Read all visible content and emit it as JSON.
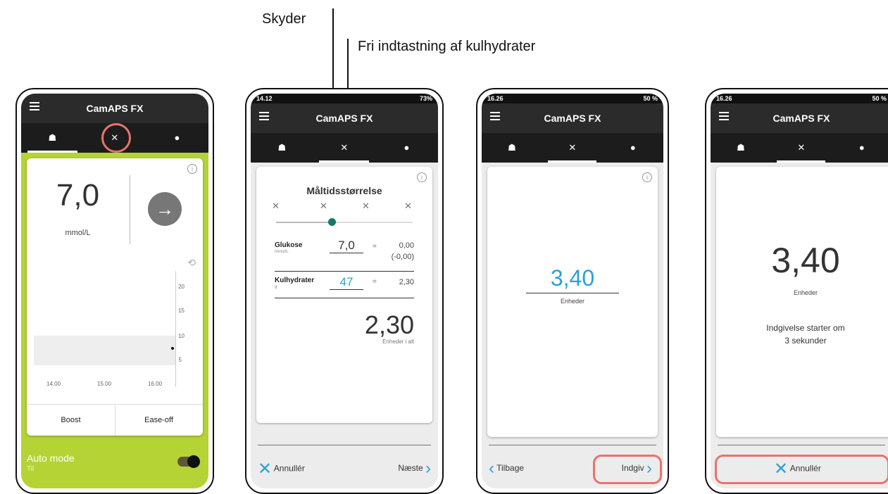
{
  "callouts": {
    "slider": "Skyder",
    "free_entry": "Fri indtastning af kulhydrater"
  },
  "app": {
    "title": "CamAPS FX"
  },
  "tab_icons": {
    "home": "home-icon",
    "meal": "meal-icon",
    "drop": "drop-icon"
  },
  "tab_glyphs": {
    "home": "☗",
    "meal": "✕",
    "drop": "●"
  },
  "colors": {
    "accent": "#2aa1d9",
    "auto_mode_bg": "#b5d334",
    "highlight_ring": "#e8736b",
    "slider_teal": "#137a6b"
  },
  "phone1": {
    "glucose_value": "7,0",
    "glucose_unit": "mmol/L",
    "chart_y_ticks": [
      "20",
      "15",
      "10",
      "5"
    ],
    "chart_x_ticks": [
      "14.00",
      "15.00",
      "16.00"
    ],
    "boost_label": "Boost",
    "easeoff_label": "Ease-off",
    "auto_mode_label": "Auto mode",
    "auto_mode_state": "Til"
  },
  "phone2": {
    "status_time": "14.12",
    "status_right": "73%",
    "meal_size_title": "Måltidsstørrelse",
    "glucose_label": "Glukose",
    "glucose_unit": "mmol/L",
    "glucose_value": "7,0",
    "glucose_eq": "=",
    "glucose_result": "0,00",
    "glucose_result_sub": "(-0,00)",
    "carb_label": "Kulhydrater",
    "carb_unit": "g",
    "carb_value": "47",
    "carb_eq": "=",
    "carb_result": "2,30",
    "total_value": "2,30",
    "total_label": "Enheder i alt",
    "cancel_label": "Annullér",
    "next_label": "Næste"
  },
  "phone3": {
    "status_time": "16.26",
    "status_right": "50 %",
    "dose_value": "3,40",
    "dose_unit": "Enheder",
    "back_label": "Tilbage",
    "deliver_label": "Indgiv"
  },
  "phone4": {
    "status_time": "16.26",
    "status_right": "50 %",
    "dose_value": "3,40",
    "dose_unit": "Enheder",
    "countdown_line1": "Indgivelse starter om",
    "countdown_line2": "3 sekunder",
    "cancel_label": "Annullér"
  }
}
